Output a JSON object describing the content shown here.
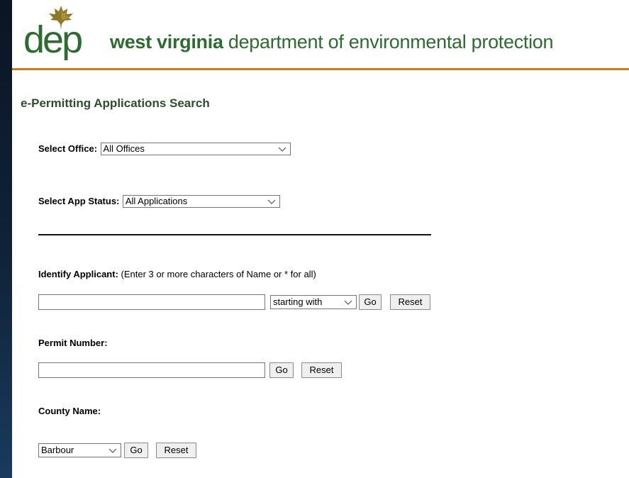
{
  "header": {
    "logo_text": "dep",
    "org_bold": "west virginia",
    "org_rest": " department of environmental protection"
  },
  "page_title": "e-Permitting Applications Search",
  "office": {
    "label": "Select Office:",
    "selected": "All Offices"
  },
  "app_status": {
    "label": "Select App Status:",
    "selected": "All Applications"
  },
  "applicant": {
    "label": "Identify Applicant:",
    "hint": "(Enter 3 or more characters of Name or * for all)",
    "value": "",
    "match_mode": "starting with",
    "go_label": "Go",
    "reset_label": "Reset"
  },
  "permit": {
    "label": "Permit Number:",
    "value": "",
    "go_label": "Go",
    "reset_label": "Reset"
  },
  "county": {
    "label": "County Name:",
    "selected": "Barbour",
    "go_label": "Go",
    "reset_label": "Reset"
  },
  "colors": {
    "brand_green": "#2e6b31",
    "accent_orange": "#c67d1e"
  }
}
